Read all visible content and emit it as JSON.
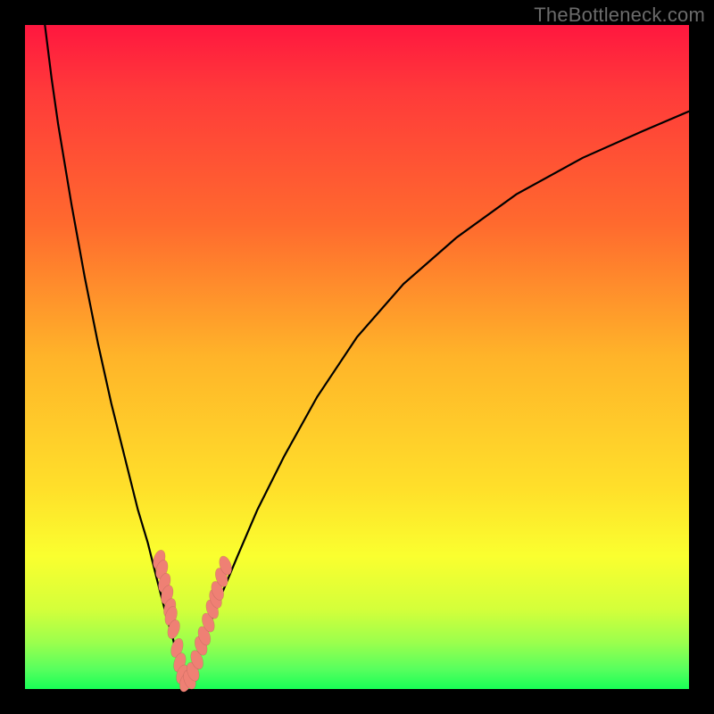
{
  "watermark": "TheBottleneck.com",
  "chart_data": {
    "type": "line",
    "title": "",
    "xlabel": "",
    "ylabel": "",
    "xlim": [
      0,
      100
    ],
    "ylim": [
      0,
      100
    ],
    "series": [
      {
        "name": "left-branch",
        "x": [
          3,
          4,
          5,
          7,
          9,
          11,
          13,
          15,
          17,
          18.5,
          20,
          21.3,
          22.3,
          23,
          23.6,
          24
        ],
        "values": [
          100,
          92,
          85,
          73,
          62,
          52,
          43,
          35,
          27,
          22,
          16,
          11,
          7.5,
          4.5,
          2,
          0.4
        ]
      },
      {
        "name": "right-branch",
        "x": [
          24,
          25,
          26,
          27.5,
          29.5,
          32,
          35,
          39,
          44,
          50,
          57,
          65,
          74,
          84,
          93,
          100
        ],
        "values": [
          0.4,
          2.5,
          5,
          9,
          14,
          20,
          27,
          35,
          44,
          53,
          61,
          68,
          74.5,
          80,
          84,
          87
        ]
      }
    ],
    "markers": {
      "name": "highlighted-points",
      "points": [
        {
          "x": 20.2,
          "y": 19.5
        },
        {
          "x": 20.6,
          "y": 18.0
        },
        {
          "x": 21.0,
          "y": 16.0
        },
        {
          "x": 21.4,
          "y": 14.2
        },
        {
          "x": 21.8,
          "y": 12.2
        },
        {
          "x": 22.0,
          "y": 11.0
        },
        {
          "x": 22.4,
          "y": 9.0
        },
        {
          "x": 22.9,
          "y": 6.2
        },
        {
          "x": 23.3,
          "y": 4.0
        },
        {
          "x": 23.7,
          "y": 2.2
        },
        {
          "x": 24.2,
          "y": 1.0
        },
        {
          "x": 24.8,
          "y": 1.4
        },
        {
          "x": 25.3,
          "y": 2.6
        },
        {
          "x": 25.9,
          "y": 4.4
        },
        {
          "x": 26.5,
          "y": 6.5
        },
        {
          "x": 27.0,
          "y": 8.0
        },
        {
          "x": 27.6,
          "y": 10.0
        },
        {
          "x": 28.2,
          "y": 12.0
        },
        {
          "x": 28.7,
          "y": 13.6
        },
        {
          "x": 29.0,
          "y": 14.8
        },
        {
          "x": 29.6,
          "y": 16.8
        },
        {
          "x": 30.2,
          "y": 18.6
        }
      ]
    },
    "background_gradient": {
      "top": "#ff173f",
      "mid": "#ffe02a",
      "bottom": "#18ff56"
    }
  }
}
